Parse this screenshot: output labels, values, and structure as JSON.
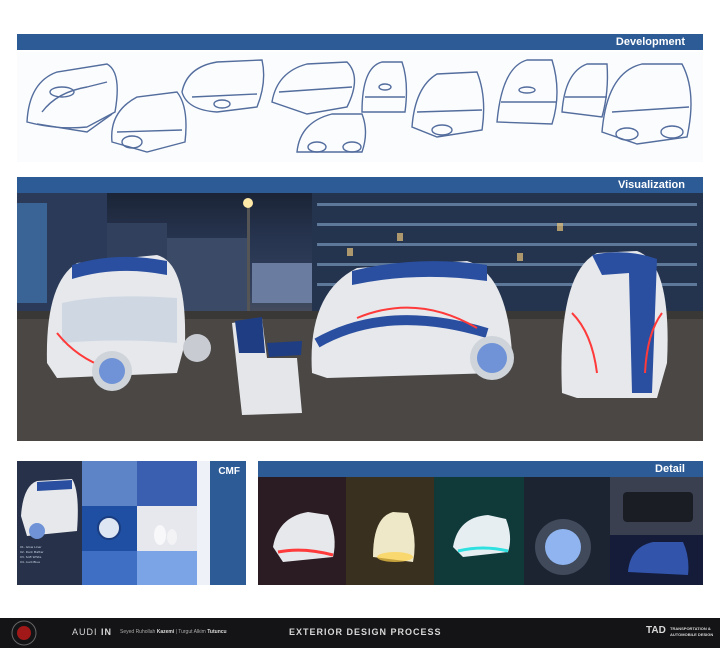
{
  "sections": {
    "development": "Development",
    "visualization": "Visualization",
    "cmf": "CMF",
    "detail": "Detail"
  },
  "cmf_caption_lines": [
    "01. Glow Liner",
    "02. Dark Matter",
    "03. Soft White",
    "04. Audi Blue"
  ],
  "footer": {
    "brand": "AUDI",
    "brand_suffix": "IN",
    "designer_prefix": "Seyed Ruhollah",
    "designer_name": "Kazemi",
    "separator": "|",
    "advisor_prefix": "Turgut Alkim",
    "advisor_name": "Tutuncu",
    "process_title": "EXTERIOR DESIGN PROCESS",
    "school_logo": "TAD",
    "school_line1": "TRANSPORTATION &",
    "school_line2": "AUTOMOBILE DESIGN"
  },
  "colors": {
    "accent": "#2d5b96",
    "footer_bg": "#141416",
    "pod_white": "#e6e8ec",
    "pod_blue": "#2a4fa0",
    "light_red": "#ff3a3a"
  }
}
